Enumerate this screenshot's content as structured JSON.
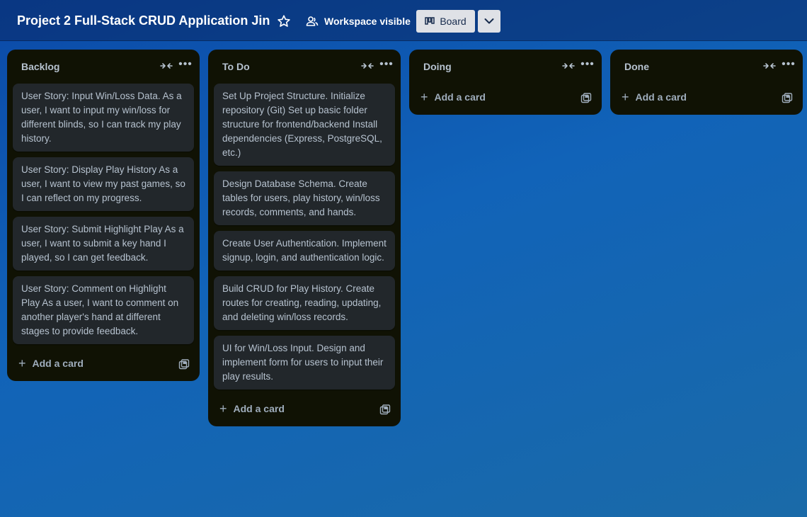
{
  "header": {
    "board_title": "Project 2 Full-Stack CRUD Application Jin",
    "star_icon": "star-icon",
    "visibility_label": "Workspace visible",
    "view_label": "Board",
    "view_menu_icon": "chevron-down-icon"
  },
  "lists": [
    {
      "title": "Backlog",
      "cards": [
        "User Story: Input Win/Loss Data. As a user, I want to input my win/loss for different blinds, so I can track my play history.",
        "User Story: Display Play History As a user, I want to view my past games, so I can reflect on my progress.",
        "User Story: Submit Highlight Play As a user, I want to submit a key hand I played, so I can get feedback.",
        "User Story: Comment on Highlight Play As a user, I want to comment on another player's hand at different stages to provide feedback."
      ],
      "add_card_label": "Add a card"
    },
    {
      "title": "To Do",
      "cards": [
        "Set Up Project Structure. Initialize repository (Git) Set up basic folder structure for frontend/backend Install dependencies (Express, PostgreSQL, etc.)",
        "Design Database Schema. Create tables for users, play history, win/loss records, comments, and hands.",
        "Create User Authentication. Implement signup, login, and authentication logic.",
        "Build CRUD for Play History. Create routes for creating, reading, updating, and deleting win/loss records.",
        "UI for Win/Loss Input. Design and implement form for users to input their play results."
      ],
      "add_card_label": "Add a card"
    },
    {
      "title": "Doing",
      "cards": [],
      "add_card_label": "Add a card"
    },
    {
      "title": "Done",
      "cards": [],
      "add_card_label": "Add a card"
    }
  ],
  "colors": {
    "board_background": "#1163b8",
    "list_background": "#101204",
    "card_background": "#22272b",
    "text": "#b6c2cf"
  }
}
